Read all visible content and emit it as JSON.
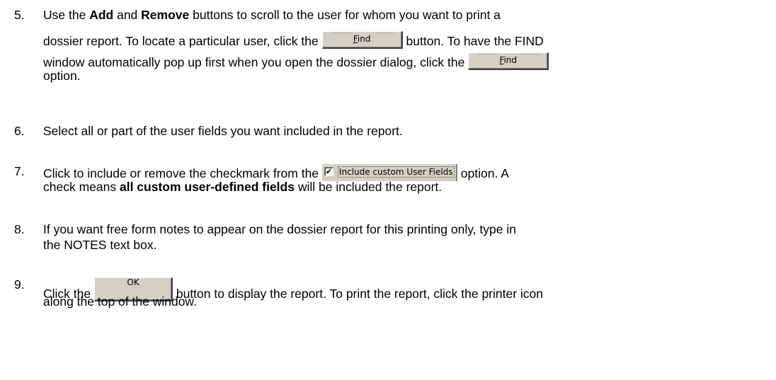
{
  "steps": [
    {
      "number": "5.",
      "line1": {
        "pre": "Use the ",
        "bold1": "Add",
        "mid": " and ",
        "bold2": "Remove",
        "post": " buttons to scroll to the user for whom you want to print a"
      },
      "line2": {
        "pre": "dossier report. To locate a particular user, click the",
        "post": "button. To have the FIND"
      },
      "line3": {
        "pre": "window automatically pop up first when you open the dossier dialog, click the"
      },
      "line4": "option.",
      "find_button": {
        "first": "F",
        "rest": "ind"
      }
    },
    {
      "number": "6.",
      "line1": "Select all or part of the user fields you want included in the report."
    },
    {
      "number": "7.",
      "line1": {
        "pre": "Click to include or remove the checkmark from the",
        "post": "option. A"
      },
      "line2": {
        "pre": "check means ",
        "bold": "all custom user-defined fields",
        "post": " will be included the report."
      },
      "checkbox": {
        "checked": true,
        "mark": "✔",
        "label": "Include custom User Fields"
      }
    },
    {
      "number": "8.",
      "line1": "If you want free form notes to appear on the dossier report for this printing only, type in",
      "line2": "the NOTES text box."
    },
    {
      "number": "9.",
      "line1": {
        "pre": "Click the",
        "post": "button to display the report. To print the report, click the printer icon"
      },
      "line2": "along the top of the window.",
      "ok_button": "OK"
    }
  ]
}
